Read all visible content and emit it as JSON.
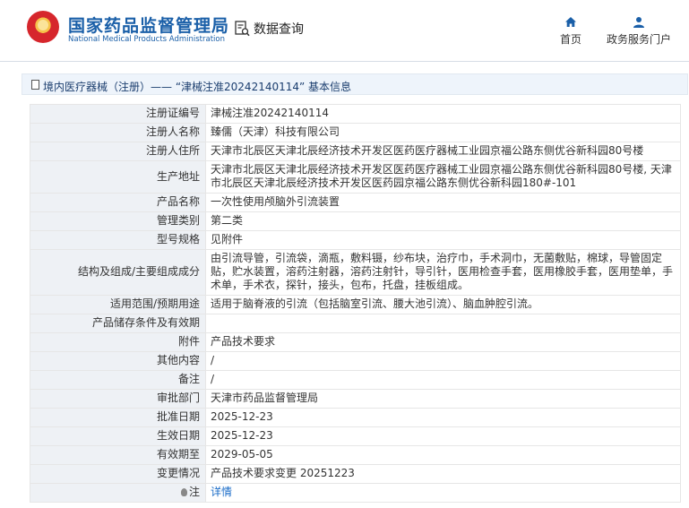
{
  "header": {
    "brand_cn": "国家药品监督管理局",
    "brand_en": "National Medical Products Administration",
    "query_label": "数据查询",
    "nav": {
      "home": "首页",
      "portal": "政务服务门户"
    },
    "colors": {
      "brand": "#1a5fa8",
      "accent": "#1a6cc8",
      "label_bg": "#eef1f5"
    }
  },
  "breadcrumb": {
    "text": "境内医疗器械（注册）—— “津械注准20242140114” 基本信息"
  },
  "details": [
    {
      "label": "注册证编号",
      "value": "津械注准20242140114"
    },
    {
      "label": "注册人名称",
      "value": "臻儒（天津）科技有限公司"
    },
    {
      "label": "注册人住所",
      "value": "天津市北辰区天津北辰经济技术开发区医药医疗器械工业园京福公路东侧优谷新科园80号楼"
    },
    {
      "label": "生产地址",
      "value": "天津市北辰区天津北辰经济技术开发区医药医疗器械工业园京福公路东侧优谷新科园80号楼, 天津市北辰区天津北辰经济技术开发区医药园京福公路东侧优谷新科园180#-101"
    },
    {
      "label": "产品名称",
      "value": "一次性使用颅脑外引流装置"
    },
    {
      "label": "管理类别",
      "value": "第二类"
    },
    {
      "label": "型号规格",
      "value": "见附件"
    },
    {
      "label": "结构及组成/主要组成成分",
      "value": "由引流导管，引流袋，滴瓶，敷料镊，纱布块，治疗巾，手术洞巾，无菌敷贴，棉球，导管固定贴，贮水装置，溶药注射器，溶药注射针，导引针，医用检查手套，医用橡胶手套，医用垫单，手术单，手术衣，探针，接头，包布，托盘，挂板组成。"
    },
    {
      "label": "适用范围/预期用途",
      "value": "适用于脑脊液的引流（包括脑室引流、腰大池引流）、脑血肿腔引流。"
    },
    {
      "label": "产品储存条件及有效期",
      "value": ""
    },
    {
      "label": "附件",
      "value": "产品技术要求"
    },
    {
      "label": "其他内容",
      "value": "/"
    },
    {
      "label": "备注",
      "value": "/"
    },
    {
      "label": "审批部门",
      "value": "天津市药品监督管理局"
    },
    {
      "label": "批准日期",
      "value": "2025-12-23"
    },
    {
      "label": "生效日期",
      "value": "2025-12-23"
    },
    {
      "label": "有效期至",
      "value": "2029-05-05"
    },
    {
      "label": "变更情况",
      "value": "产品技术要求变更 20251223"
    }
  ],
  "note": {
    "label": "注",
    "link": "详情",
    "icon": "lightbulb-icon"
  }
}
